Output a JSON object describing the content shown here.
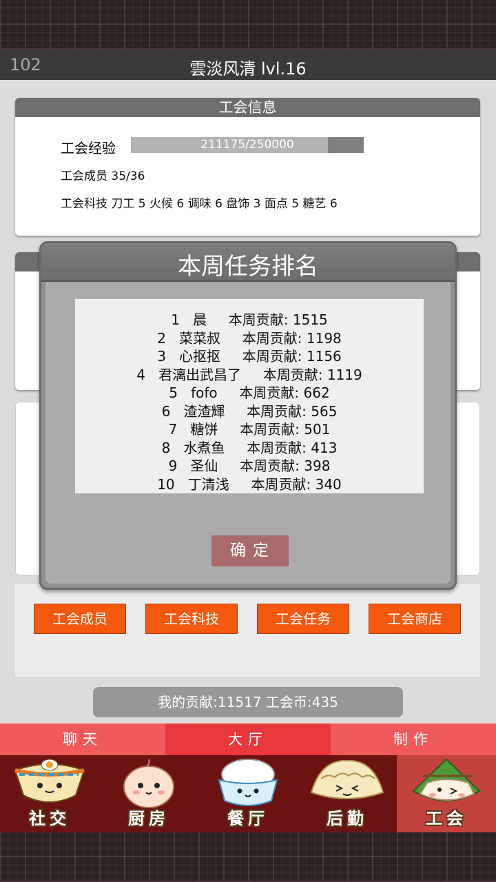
{
  "header": {
    "number": "102",
    "title": "雲淡风清 lvl.16"
  },
  "guild_info": {
    "heading": "工会信息",
    "xp_label": "工会经验",
    "xp_text": "211175/250000",
    "xp_fraction": 0.8447,
    "members_text": "工会成员  35/36",
    "tech_text": "工会科技  刀工 5  火候 6  调味 6  盘饰 3  面点 5  糖艺 6"
  },
  "modal": {
    "title": "本周任务排名",
    "rows": [
      "1   晨     本周贡献: 1515",
      "2   菜菜叔     本周贡献: 1198",
      "3   心抠抠     本周贡献: 1156",
      "4   君漓出武昌了     本周贡献: 1119",
      "5   fofo     本周贡献: 662",
      "6   渣渣輝     本周贡献: 565",
      "7   糖饼     本周贡献: 501",
      "8   水煮鱼     本周贡献: 413",
      "9   圣仙     本周贡献: 398",
      "10   丁清浅     本周贡献: 340"
    ],
    "confirm_label": "确定"
  },
  "actions": [
    "工会成员",
    "工会科技",
    "工会任务",
    "工会商店"
  ],
  "contribution_text": "我的贡献:11517  工会币:435",
  "bottom_tabs": [
    "聊天",
    "大厅",
    "制作"
  ],
  "nav": [
    {
      "label": "社交",
      "icon": "noodle-bowl-icon"
    },
    {
      "label": "厨房",
      "icon": "bun-icon"
    },
    {
      "label": "餐厅",
      "icon": "rice-bowl-icon"
    },
    {
      "label": "后勤",
      "icon": "dumpling-icon"
    },
    {
      "label": "工会",
      "icon": "zongzi-icon"
    }
  ],
  "colors": {
    "accent_orange": "#f4590f",
    "tab_red": "#f05a5c",
    "nav_dark": "#6b1313",
    "nav_active": "#c3423f"
  }
}
